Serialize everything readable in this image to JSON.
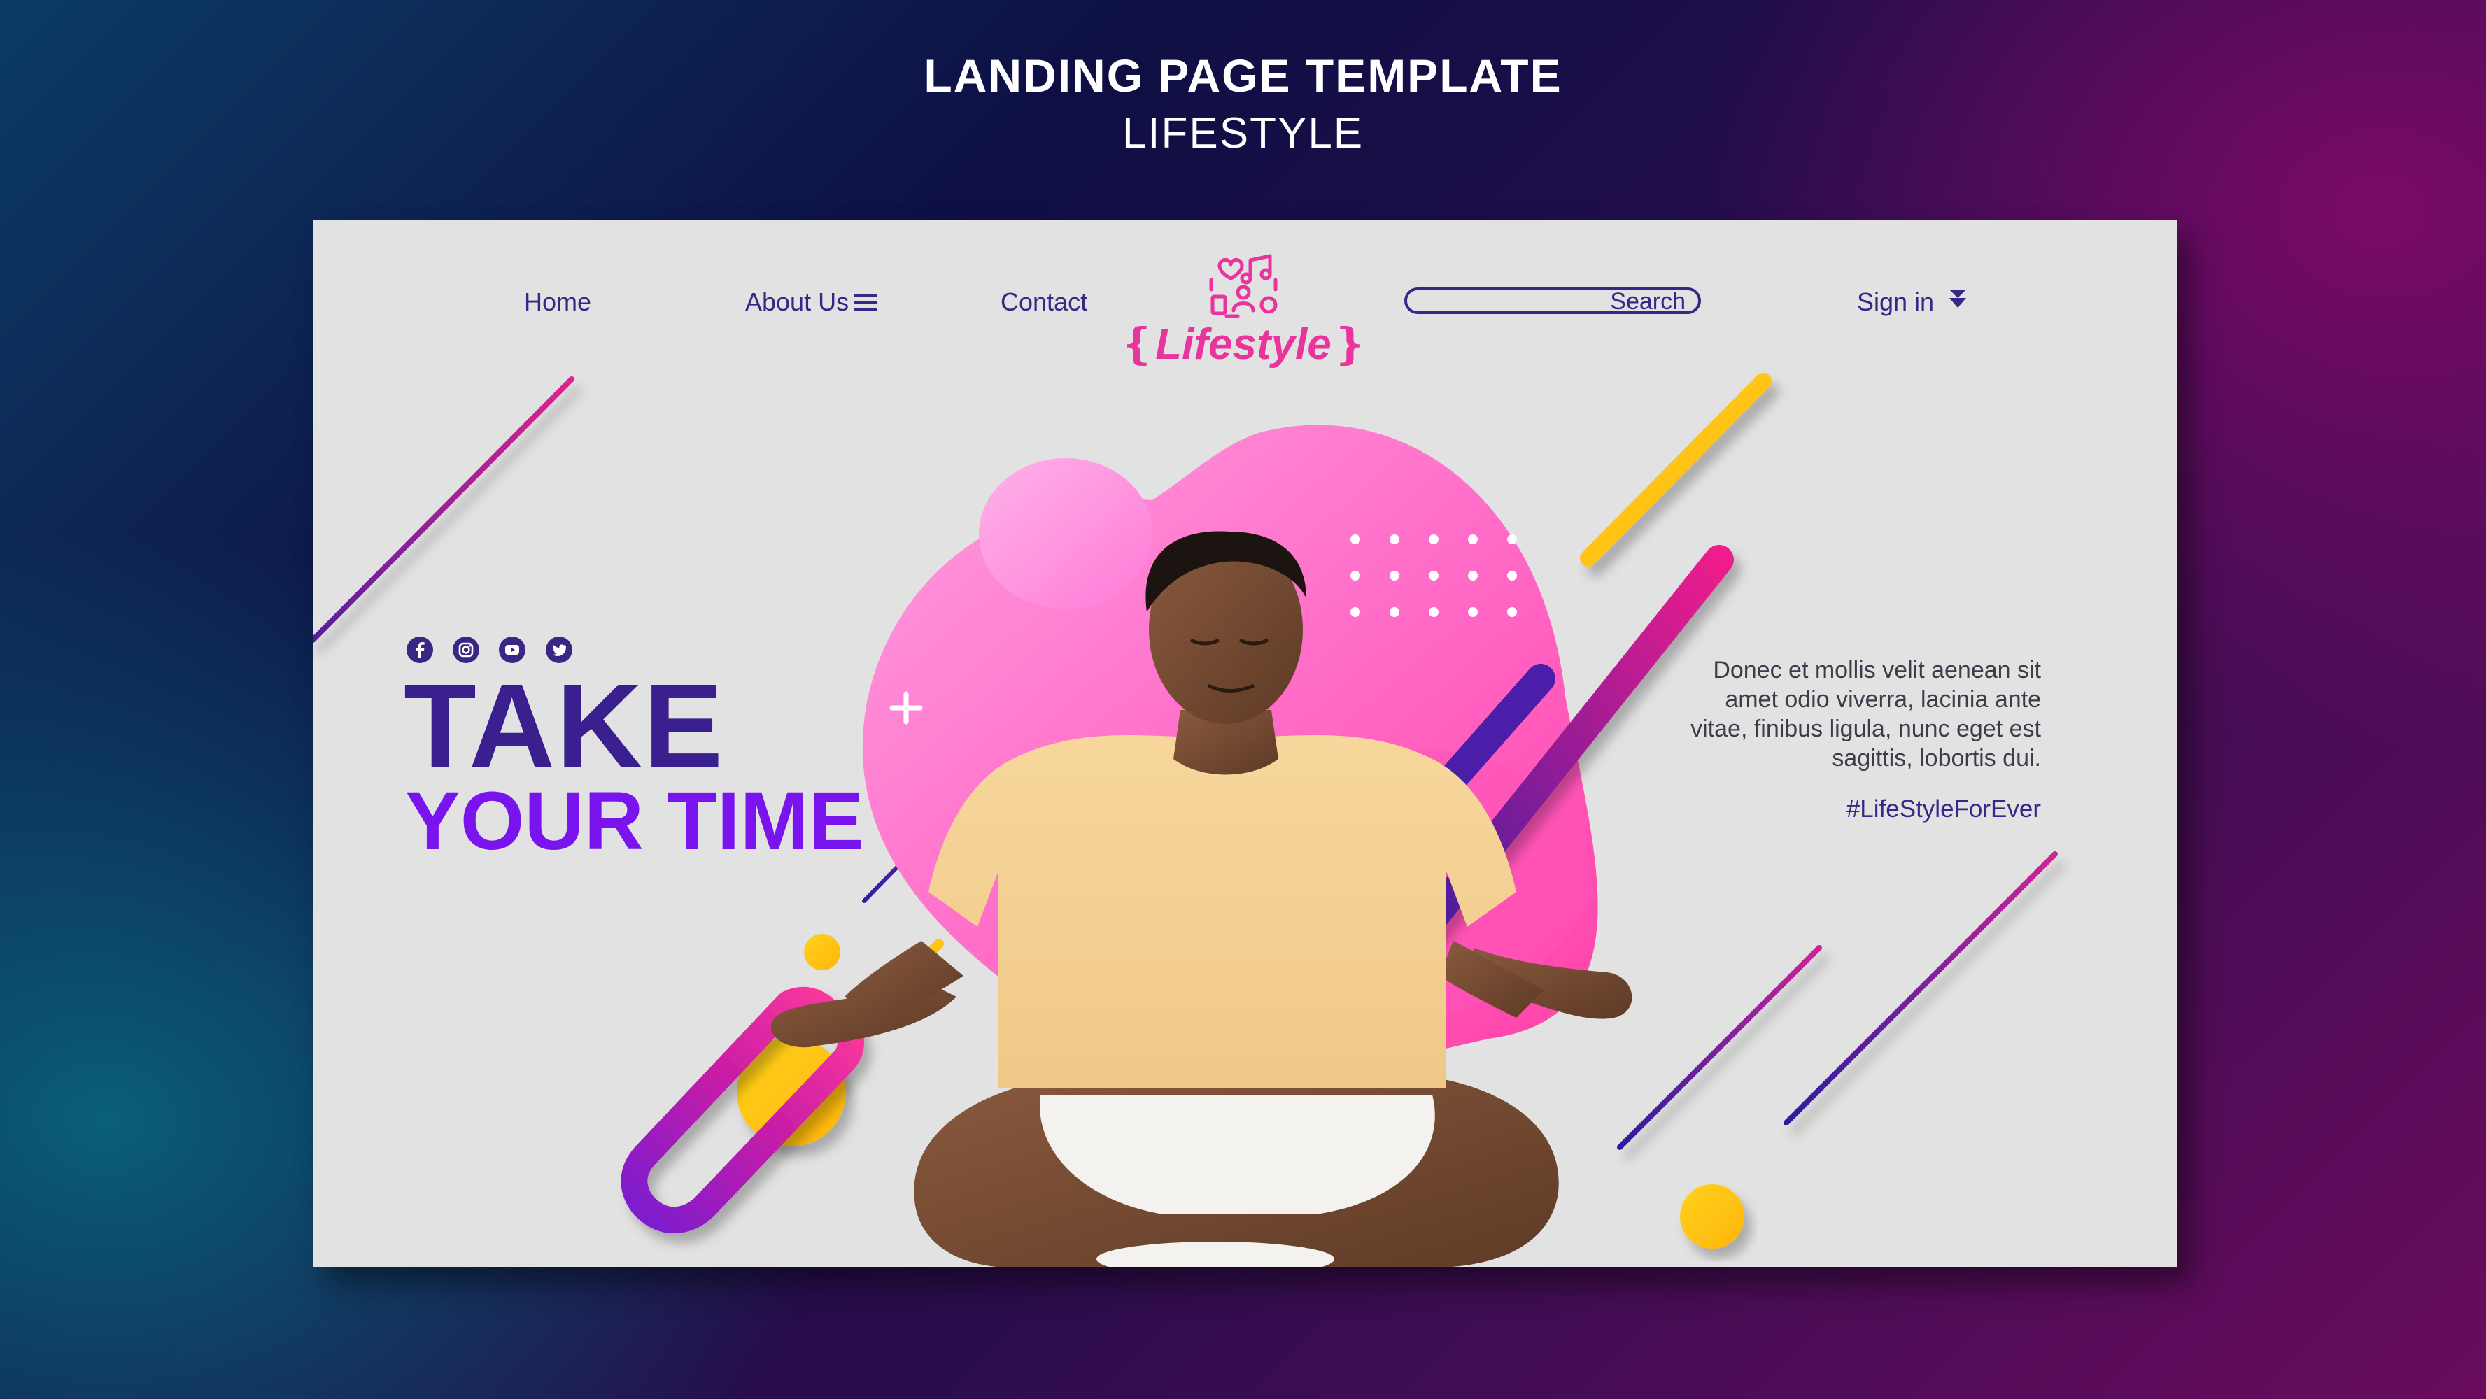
{
  "header": {
    "title": "LANDING PAGE TEMPLATE",
    "subtitle": "LIFESTYLE"
  },
  "nav": {
    "home": "Home",
    "about": "About Us",
    "contact": "Contact",
    "search_label": "Search",
    "signin": "Sign in"
  },
  "logo": {
    "text": "❴Lifestyle❵",
    "icon": "lifestyle-icon"
  },
  "social": [
    "facebook-icon",
    "instagram-icon",
    "youtube-icon",
    "twitter-icon"
  ],
  "hero": {
    "line1": "TAKE",
    "line2": "YOUR TIME"
  },
  "content": {
    "description": "Donec et mollis velit aenean sit amet odio viverra, lacinia ante vitae, finibus ligula, nunc eget est sagittis, lobortis dui.",
    "hashtag": "#LifeStyleForEver"
  },
  "colors": {
    "primary": "#3a2785",
    "accent_purple": "#7a14ee",
    "accent_pink": "#e8349c",
    "accent_yellow": "#ffc21a",
    "card_bg": "#e2e2e2"
  }
}
